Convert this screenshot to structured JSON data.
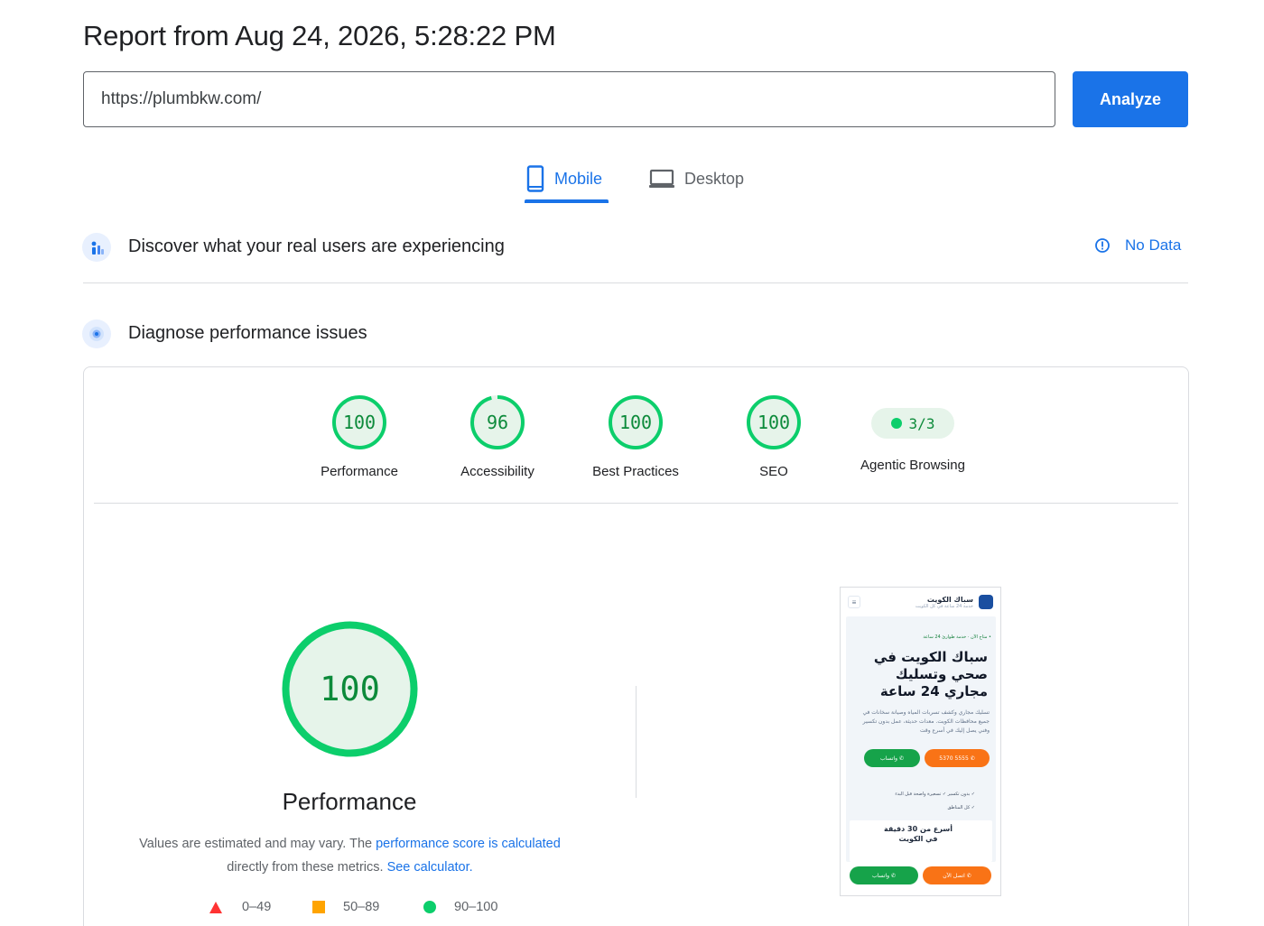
{
  "report": {
    "title": "Report from Aug 24, 2026, 5:28:22 PM"
  },
  "search": {
    "url_value": "https://plumbkw.com/",
    "analyze_label": "Analyze"
  },
  "tabs": {
    "mobile": "Mobile",
    "desktop": "Desktop",
    "active": "Mobile"
  },
  "field_data": {
    "title": "Discover what your real users are experiencing",
    "status": "No Data"
  },
  "diagnose": {
    "title": "Diagnose performance issues"
  },
  "scores": [
    {
      "label": "Performance",
      "value": "100"
    },
    {
      "label": "Accessibility",
      "value": "96"
    },
    {
      "label": "Best Practices",
      "value": "100"
    },
    {
      "label": "SEO",
      "value": "100"
    }
  ],
  "agentic": {
    "label": "Agentic Browsing",
    "value": "3/3"
  },
  "performance": {
    "score": "100",
    "label": "Performance",
    "desc_prefix": "Values are estimated and may vary. The ",
    "desc_link1": "performance score is calculated",
    "desc_middle": "directly from these metrics. ",
    "desc_link2": "See calculator."
  },
  "legend": {
    "fail": "0–49",
    "average": "50–89",
    "pass": "90–100"
  },
  "screenshot": {
    "brand": "سباك الكويت",
    "brand_sub": "خدمة 24 ساعة في كل الكويت",
    "badge": "• متاح الآن · خدمة طوارئ 24 ساعة",
    "heading": "سباك الكويت في صحي وتسليك مجاري 24 ساعة",
    "paragraph": "تسليك مجاري وكشف تسربات المياه وصيانة سخانات في جميع محافظات الكويت. معدات حديثة، عمل بدون تكسير وفني يصل إليك في أسرع وقت",
    "btn_call": "✆ 5555 5370",
    "btn_whatsapp": "✆ واتساب",
    "feat1": "✓ بدون تكسير   ✓ تسعيرة واضحة قبل البدء",
    "feat2": "✓ كل المناطق",
    "card_title": "أسرع من 30 دقيقة في الكويت",
    "bottom_call": "✆ اتصل الآن",
    "bottom_whatsapp": "✆ واتساب"
  },
  "colors": {
    "accent": "#1a73e8",
    "pass": "#0cce6b",
    "pass_text": "#0c8a3a",
    "average": "#ffa400",
    "fail": "#ff3333"
  },
  "icons": {
    "mobile": "smartphone-icon",
    "desktop": "laptop-icon",
    "field": "users-chart-icon",
    "diagnose": "radar-icon",
    "info": "info-icon"
  }
}
